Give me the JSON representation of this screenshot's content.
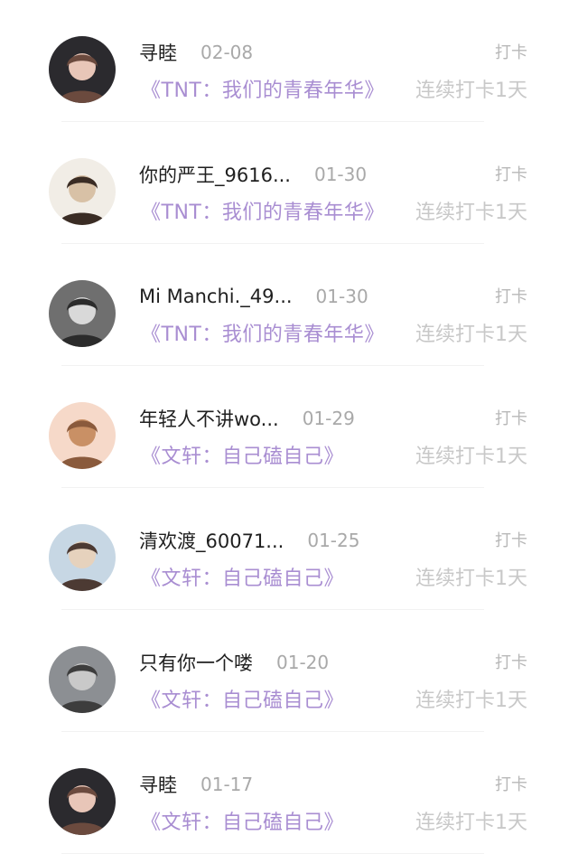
{
  "checkins": [
    {
      "user_name": "寻睦",
      "date": "02-08",
      "topic": "《TNT：我们的青春年华》",
      "action": "打卡",
      "streak": "连续打卡1天",
      "avatar_colors": [
        "#2b2a2e",
        "#e8c6b8",
        "#6b4a3e"
      ]
    },
    {
      "user_name": "你的严王_9616...",
      "date": "01-30",
      "topic": "《TNT：我们的青春年华》",
      "action": "打卡",
      "streak": "连续打卡1天",
      "avatar_colors": [
        "#f1ede6",
        "#d8c1a6",
        "#3a2c24"
      ]
    },
    {
      "user_name": "Mi Manchi._49...",
      "date": "01-30",
      "topic": "《TNT：我们的青春年华》",
      "action": "打卡",
      "streak": "连续打卡1天",
      "avatar_colors": [
        "#6f6f6f",
        "#d9d9d9",
        "#2b2b2b"
      ]
    },
    {
      "user_name": "年轻人不讲wo...",
      "date": "01-29",
      "topic": "《文轩：自己磕自己》",
      "action": "打卡",
      "streak": "连续打卡1天",
      "avatar_colors": [
        "#f6d9c9",
        "#c99065",
        "#8a5a3c"
      ]
    },
    {
      "user_name": "清欢渡_60071...",
      "date": "01-25",
      "topic": "《文轩：自己磕自己》",
      "action": "打卡",
      "streak": "连续打卡1天",
      "avatar_colors": [
        "#c7d7e4",
        "#e6d2bd",
        "#4c3a33"
      ]
    },
    {
      "user_name": "只有你一个喽",
      "date": "01-20",
      "topic": "《文轩：自己磕自己》",
      "action": "打卡",
      "streak": "连续打卡1天",
      "avatar_colors": [
        "#8c8f93",
        "#c9c9c9",
        "#3d3d3d"
      ]
    },
    {
      "user_name": "寻睦",
      "date": "01-17",
      "topic": "《文轩：自己磕自己》",
      "action": "打卡",
      "streak": "连续打卡1天",
      "avatar_colors": [
        "#2b2a2e",
        "#e8c6b8",
        "#6b4a3e"
      ]
    }
  ]
}
